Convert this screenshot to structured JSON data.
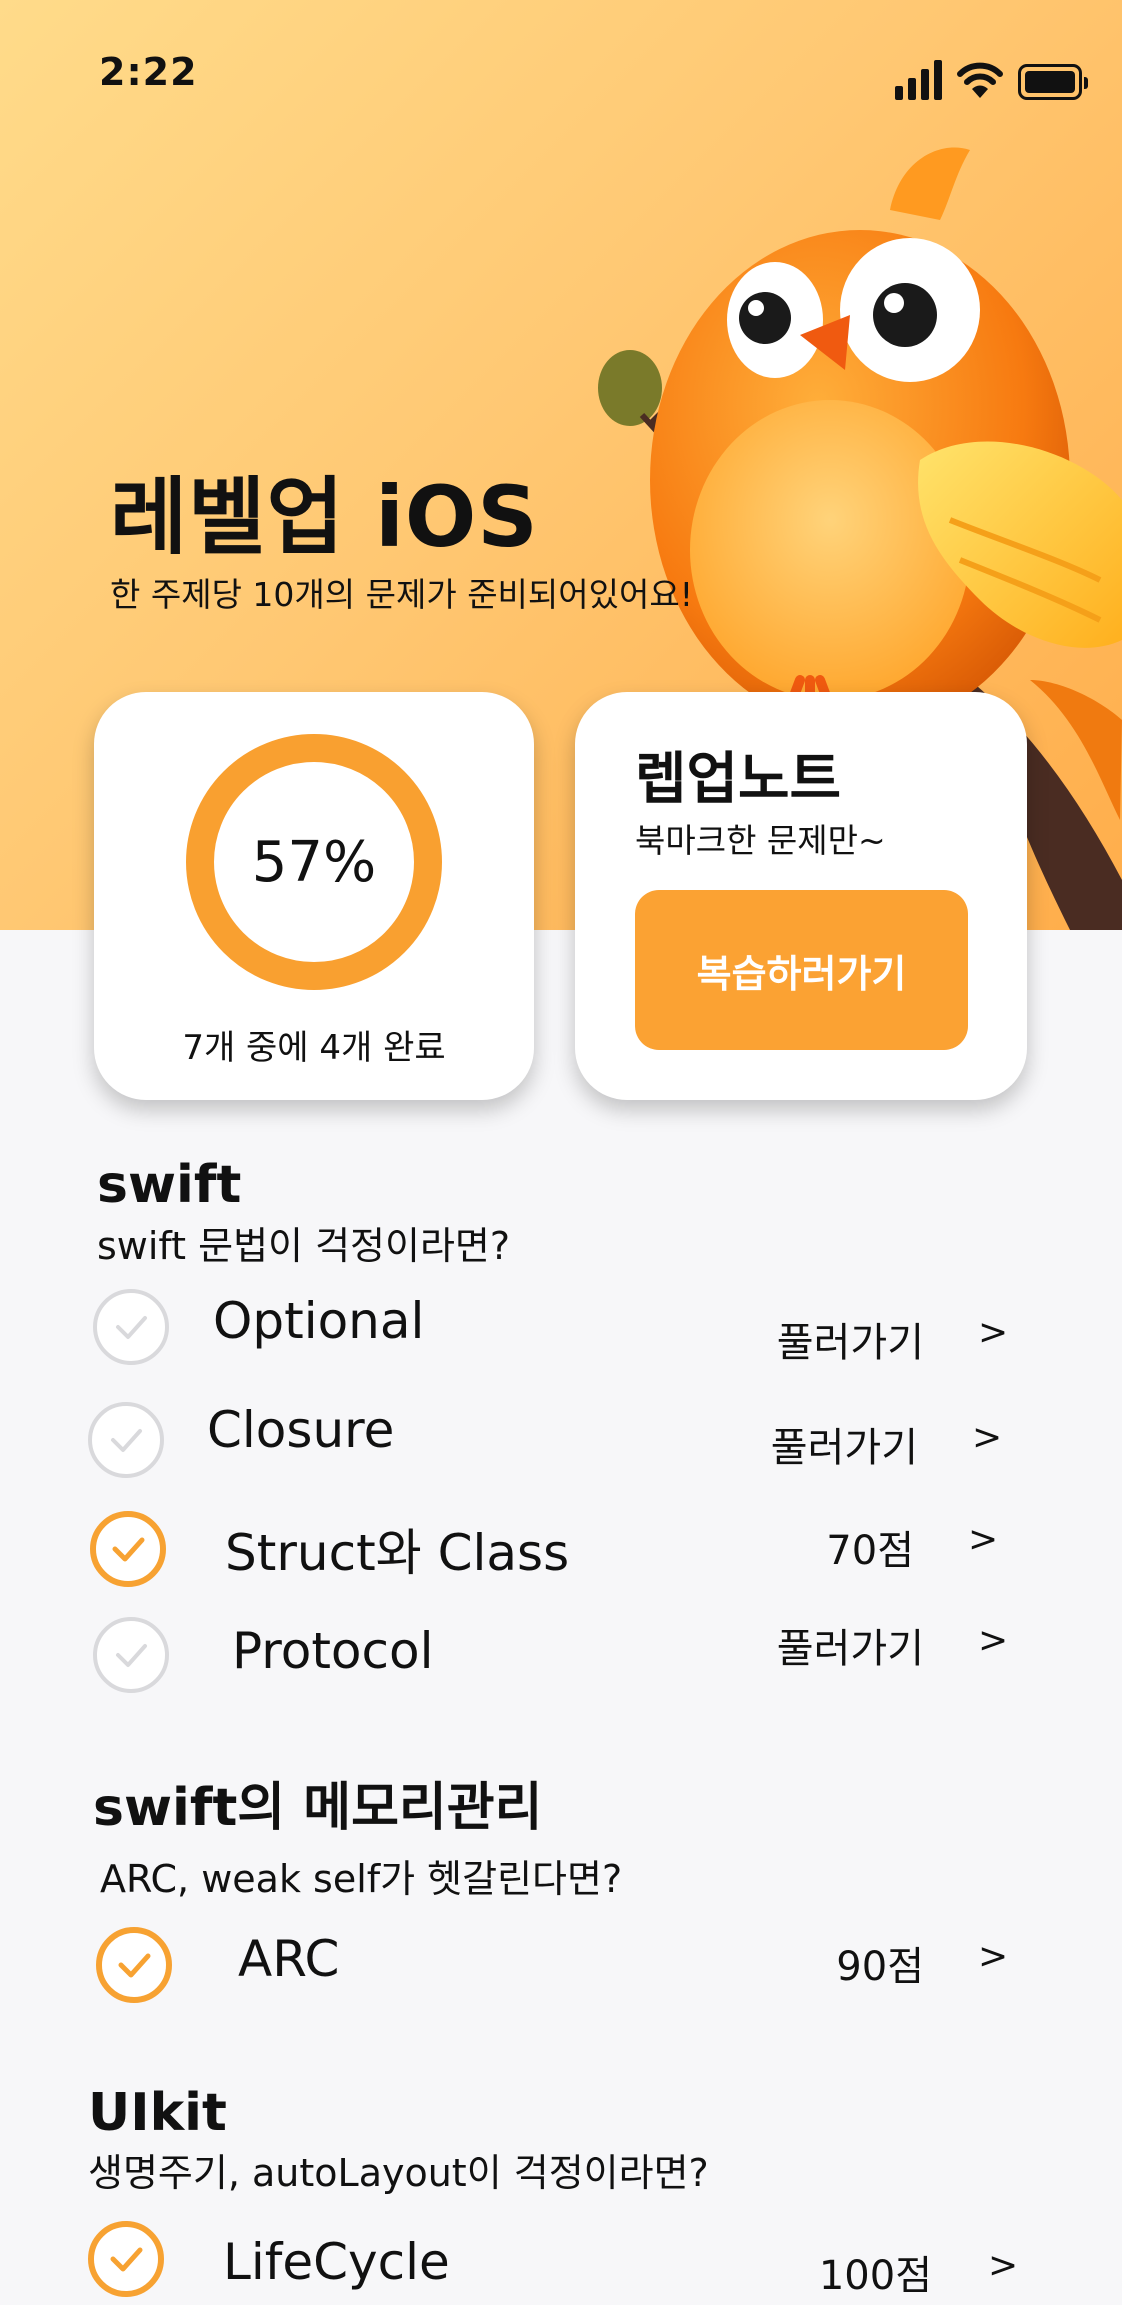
{
  "status_bar": {
    "time": "2:22"
  },
  "hero": {
    "title": "레벨업 iOS",
    "subtitle": "한 주제당 10개의 문제가 준비되어있어요!"
  },
  "progress_card": {
    "percent_label": "57%",
    "progress_fraction": 0.57,
    "caption": "7개 중에 4개 완료"
  },
  "note_card": {
    "title": "렙업노트",
    "subtitle": "북마크한 문제만~",
    "button_label": "복습하러가기"
  },
  "colors": {
    "accent": "#fba233",
    "ring": "#f9a030",
    "check_off": "#d9d9dc",
    "background": "#f7f7f9"
  },
  "sections": [
    {
      "title": "swift",
      "subtitle": "swift 문법이 걱정이라면?",
      "items": [
        {
          "label": "Optional",
          "status": "풀러가기",
          "chevron": ">",
          "done": false,
          "icon": "check-circle-icon"
        },
        {
          "label": "Closure",
          "status": "풀러가기",
          "chevron": ">",
          "done": false,
          "icon": "check-circle-icon"
        },
        {
          "label": "Struct와 Class",
          "status": "70점",
          "chevron": ">",
          "done": true,
          "icon": "check-circle-icon"
        },
        {
          "label": "Protocol",
          "status": "풀러가기",
          "chevron": ">",
          "done": false,
          "icon": "check-circle-icon"
        }
      ]
    },
    {
      "title": "swift의 메모리관리",
      "subtitle": "ARC, weak self가 헷갈린다면?",
      "items": [
        {
          "label": "ARC",
          "status": "90점",
          "chevron": ">",
          "done": true,
          "icon": "check-circle-icon"
        }
      ]
    },
    {
      "title": "UIkit",
      "subtitle": "생명주기,  autoLayout이 걱정이라면?",
      "items": [
        {
          "label": "LifeCycle",
          "status": "100점",
          "chevron": ">",
          "done": true,
          "icon": "check-circle-icon"
        }
      ]
    }
  ]
}
